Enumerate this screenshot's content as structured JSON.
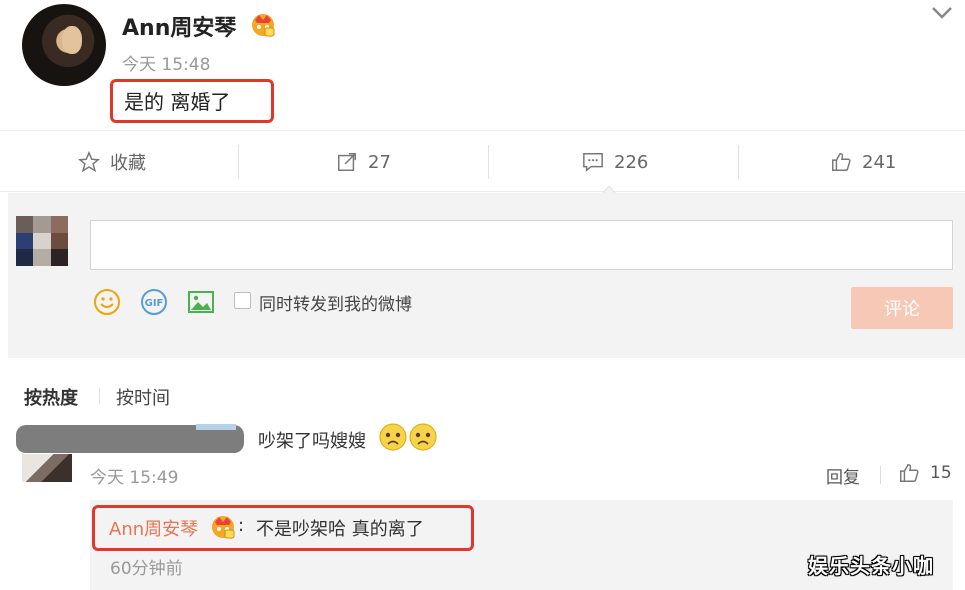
{
  "post": {
    "username": "Ann周安琴",
    "time": "今天 15:48",
    "text": "是的 离婚了"
  },
  "actions": {
    "favorite_label": "收藏",
    "repost_count": "27",
    "comment_count": "226",
    "like_count": "241"
  },
  "composer": {
    "input_value": "",
    "repost_option_label": "同时转发到我的微博",
    "submit_label": "评论",
    "icons": [
      "smiley-icon",
      "gif-icon",
      "image-icon"
    ]
  },
  "sort": {
    "hot_label": "按热度",
    "time_label": "按时间"
  },
  "comments": [
    {
      "text": "吵架了吗嫂嫂",
      "time": "今天 15:49",
      "reply_label": "回复",
      "like_count": "15",
      "replies": [
        {
          "author": "Ann周安琴",
          "separator": ":",
          "text": "不是吵架哈 真的离了",
          "time": "60分钟前"
        }
      ]
    }
  ],
  "watermark": "娱乐头条小咖",
  "colors": {
    "highlight_red": "#e0362b",
    "author_orange": "#eb7350",
    "submit_disabled": "#f8c8b6"
  }
}
